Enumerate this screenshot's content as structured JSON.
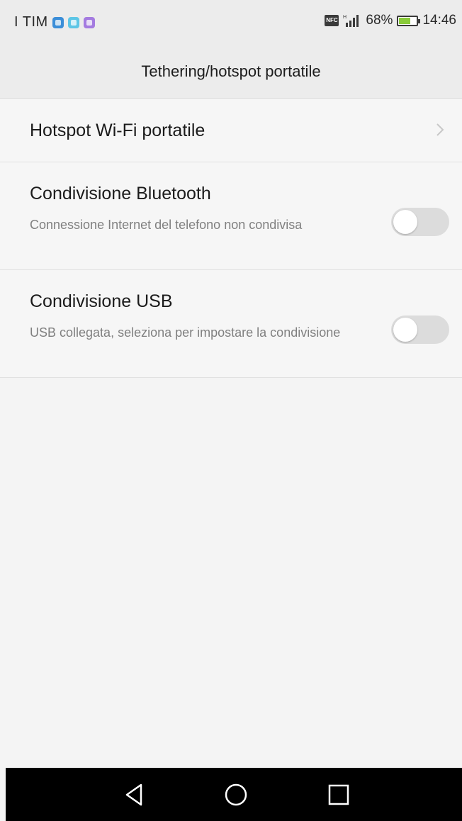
{
  "status_bar": {
    "carrier": "I TIM",
    "notification_icons": [
      "app-icon-blue",
      "app-icon-cyan",
      "app-icon-purple"
    ],
    "nfc_label": "NFC",
    "battery": "68%",
    "battery_level": 0.68,
    "time": "14:46"
  },
  "header": {
    "title": "Tethering/hotspot portatile"
  },
  "items": [
    {
      "title": "Hotspot Wi-Fi portatile",
      "trailing": "chevron-right-icon"
    },
    {
      "title": "Condivisione Bluetooth",
      "subtitle": "Connessione Internet del telefono non condivisa",
      "toggle_on": false
    },
    {
      "title": "Condivisione USB",
      "subtitle": "USB collegata, seleziona per impostare la condivisione",
      "toggle_on": false
    }
  ],
  "nav_bar": {
    "buttons": [
      "back-icon",
      "home-icon",
      "recent-apps-icon"
    ]
  },
  "colors": {
    "background": "#f4f4f4",
    "toggle_off": "#dcdcdc",
    "battery_fill": "#8acb3a",
    "nav_bar": "#000000"
  }
}
